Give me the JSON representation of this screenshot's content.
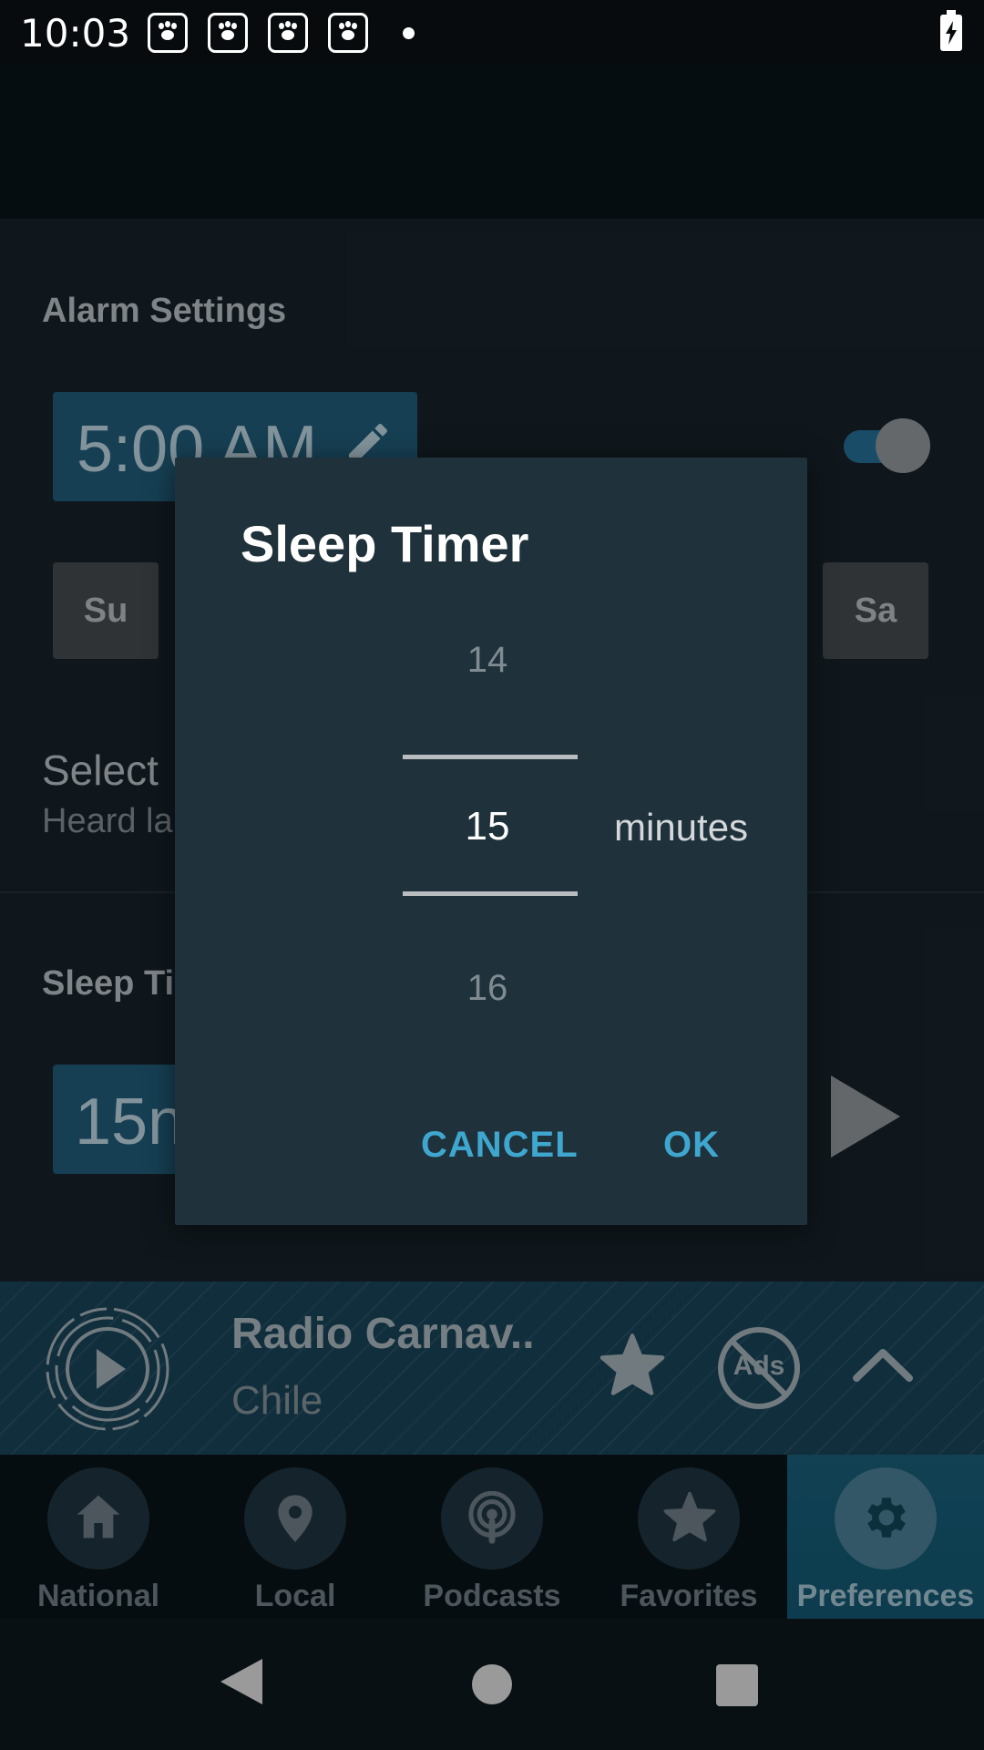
{
  "status_bar": {
    "time": "10:03",
    "notification_icons": [
      "baidu-paw-icon",
      "baidu-paw-icon",
      "baidu-paw-icon",
      "baidu-paw-icon"
    ],
    "battery_icon": "battery-charging-icon"
  },
  "settings": {
    "alarm_title": "Alarm Settings",
    "alarm_time": "5:00 AM",
    "alarm_enabled": true,
    "days": [
      "Su",
      "Sa"
    ],
    "select_label": "Select",
    "select_sub": "Heard la",
    "sleep_title": "Sleep Ti",
    "sleep_value": "15n"
  },
  "now_playing": {
    "title": "Radio Carnav..",
    "subtitle": "Chile",
    "ads_label": "Ads"
  },
  "bottom_nav": {
    "items": [
      {
        "label": "National",
        "icon": "home-icon"
      },
      {
        "label": "Local",
        "icon": "location-pin-icon"
      },
      {
        "label": "Podcasts",
        "icon": "podcast-icon"
      },
      {
        "label": "Favorites",
        "icon": "star-icon"
      },
      {
        "label": "Preferences",
        "icon": "gear-icon"
      }
    ],
    "active_index": 4
  },
  "dialog": {
    "title": "Sleep Timer",
    "prev_value": "14",
    "current_value": "15",
    "next_value": "16",
    "unit": "minutes",
    "cancel_label": "CANCEL",
    "ok_label": "OK"
  },
  "colors": {
    "accent": "#3fa7cf",
    "dialog_bg": "#1f313b",
    "nav_active": "#155066"
  }
}
